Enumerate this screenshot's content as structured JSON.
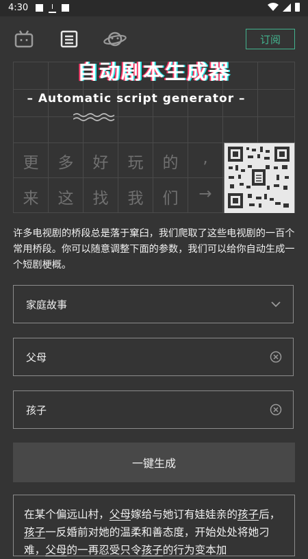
{
  "status": {
    "time": "4:30"
  },
  "nav": {
    "subscribe_label": "订阅"
  },
  "banner": {
    "title": "自动剧本生成器",
    "subtitle": "– Automatic script generator –",
    "row1": [
      "更",
      "多",
      "好",
      "玩",
      "的",
      ","
    ],
    "row2": [
      "来",
      "这",
      "找",
      "我",
      "们",
      "→"
    ]
  },
  "description": "许多电视剧的桥段总是落于窠臼，我们爬取了这些电视剧的一百个常用桥段。你可以随意调整下面的参数，我们可以给你自动生成一个短剧梗概。",
  "form": {
    "category": "家庭故事",
    "role1": "父母",
    "role2": "孩子",
    "generate_label": "一键生成"
  },
  "result": {
    "segments": [
      {
        "text": "在某个偏远山村，",
        "u": false
      },
      {
        "text": "父母",
        "u": true
      },
      {
        "text": "嫁给与她订有娃娃亲的",
        "u": false
      },
      {
        "text": "孩子",
        "u": true
      },
      {
        "text": "后，",
        "u": false
      },
      {
        "text": "孩子",
        "u": true
      },
      {
        "text": "一反婚前对她的温柔和善态度，开始处处将她刁难，",
        "u": false
      },
      {
        "text": "父母",
        "u": true
      },
      {
        "text": "的一再忍受只令",
        "u": false
      },
      {
        "text": "孩子",
        "u": true
      },
      {
        "text": "的行为变本加",
        "u": false
      }
    ]
  },
  "colors": {
    "accent": "#43b48f",
    "background": "#343434"
  },
  "icons": [
    "tv-icon",
    "document-icon",
    "planet-icon",
    "chevron-down-icon",
    "clear-icon"
  ]
}
